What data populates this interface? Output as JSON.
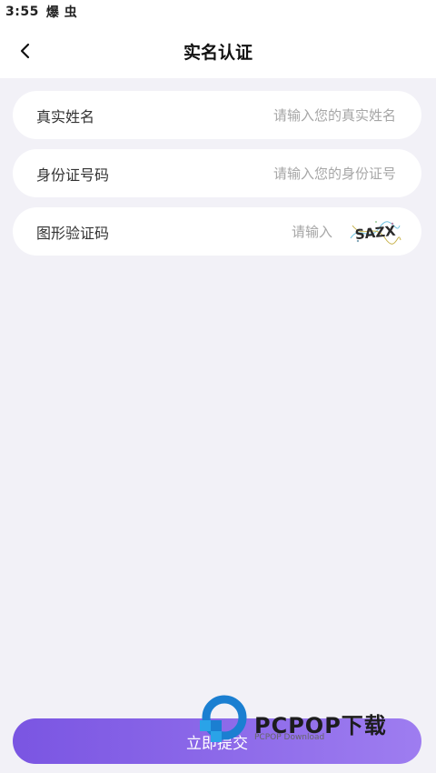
{
  "status_bar": {
    "time": "3:55",
    "app_name": "爆 虫"
  },
  "header": {
    "title": "实名认证"
  },
  "form": {
    "real_name": {
      "label": "真实姓名",
      "placeholder": "请输入您的真实姓名",
      "value": ""
    },
    "id_number": {
      "label": "身份证号码",
      "placeholder": "请输入您的身份证号",
      "value": ""
    },
    "captcha": {
      "label": "图形验证码",
      "placeholder": "请输入",
      "value": "",
      "image_text": "SAZX"
    }
  },
  "submit": {
    "label": "立即提交"
  },
  "watermark": {
    "brand": "PCPOP下载",
    "subtitle": "PCPOP Download"
  },
  "colors": {
    "background": "#f2f1f7",
    "button_gradient_start": "#7a55e2",
    "button_gradient_end": "#9e7df0",
    "placeholder": "#a6a6a6"
  }
}
